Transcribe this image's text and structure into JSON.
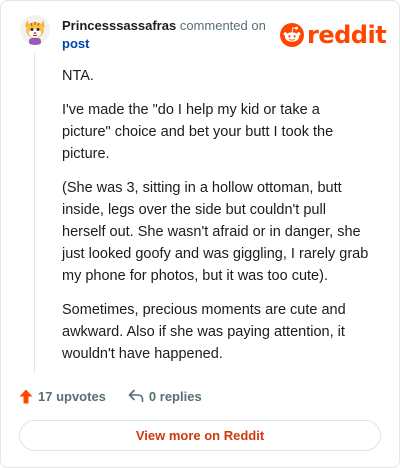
{
  "comment": {
    "author": "Princesssassafras",
    "action_text": "commented on",
    "post_link_label": "post",
    "avatar_icon": "snoo-avatar-icon",
    "body_paragraphs": [
      "NTA.",
      "I've made the \"do I help my kid or take a picture\" choice and bet your butt I took the picture.",
      "(She was 3, sitting in a hollow ottoman, butt inside, legs over the side but couldn't pull herself out. She wasn't afraid or in danger, she just looked goofy and was giggling, I rarely grab my phone for photos, but it was too cute).",
      "Sometimes, precious moments are cute and awkward. Also if she was paying attention, it wouldn't have happened."
    ]
  },
  "brand": {
    "logo_icon": "reddit-logo-icon",
    "wordmark": "reddit",
    "color": "#ff4500"
  },
  "footer": {
    "upvote_icon": "upvote-arrow-icon",
    "upvotes_label": "17 upvotes",
    "reply_icon": "reply-arrow-icon",
    "replies_label": "0 replies"
  },
  "cta": {
    "label": "View more on Reddit",
    "color": "#cf3a0c"
  }
}
